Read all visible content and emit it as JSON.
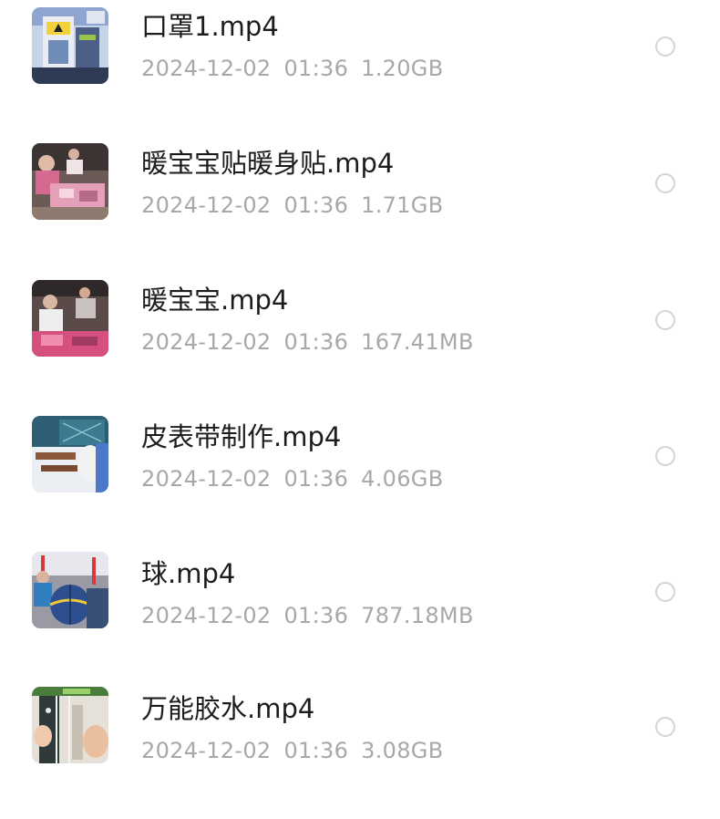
{
  "files": [
    {
      "name": "口罩1.mp4",
      "date": "2024-12-02",
      "time": "01:36",
      "size": "1.20GB",
      "thumb_icon": "machine-video-thumbnail",
      "selected": false
    },
    {
      "name": "暖宝宝贴暖身贴.mp4",
      "date": "2024-12-02",
      "time": "01:36",
      "size": "1.71GB",
      "thumb_icon": "workshop-video-thumbnail",
      "selected": false
    },
    {
      "name": "暖宝宝.mp4",
      "date": "2024-12-02",
      "time": "01:36",
      "size": "167.41MB",
      "thumb_icon": "factory-video-thumbnail",
      "selected": false
    },
    {
      "name": "皮表带制作.mp4",
      "date": "2024-12-02",
      "time": "01:36",
      "size": "4.06GB",
      "thumb_icon": "leather-strap-video-thumbnail",
      "selected": false
    },
    {
      "name": "球.mp4",
      "date": "2024-12-02",
      "time": "01:36",
      "size": "787.18MB",
      "thumb_icon": "basketball-video-thumbnail",
      "selected": false
    },
    {
      "name": "万能胶水.mp4",
      "date": "2024-12-02",
      "time": "01:36",
      "size": "3.08GB",
      "thumb_icon": "glue-video-thumbnail",
      "selected": false
    }
  ]
}
